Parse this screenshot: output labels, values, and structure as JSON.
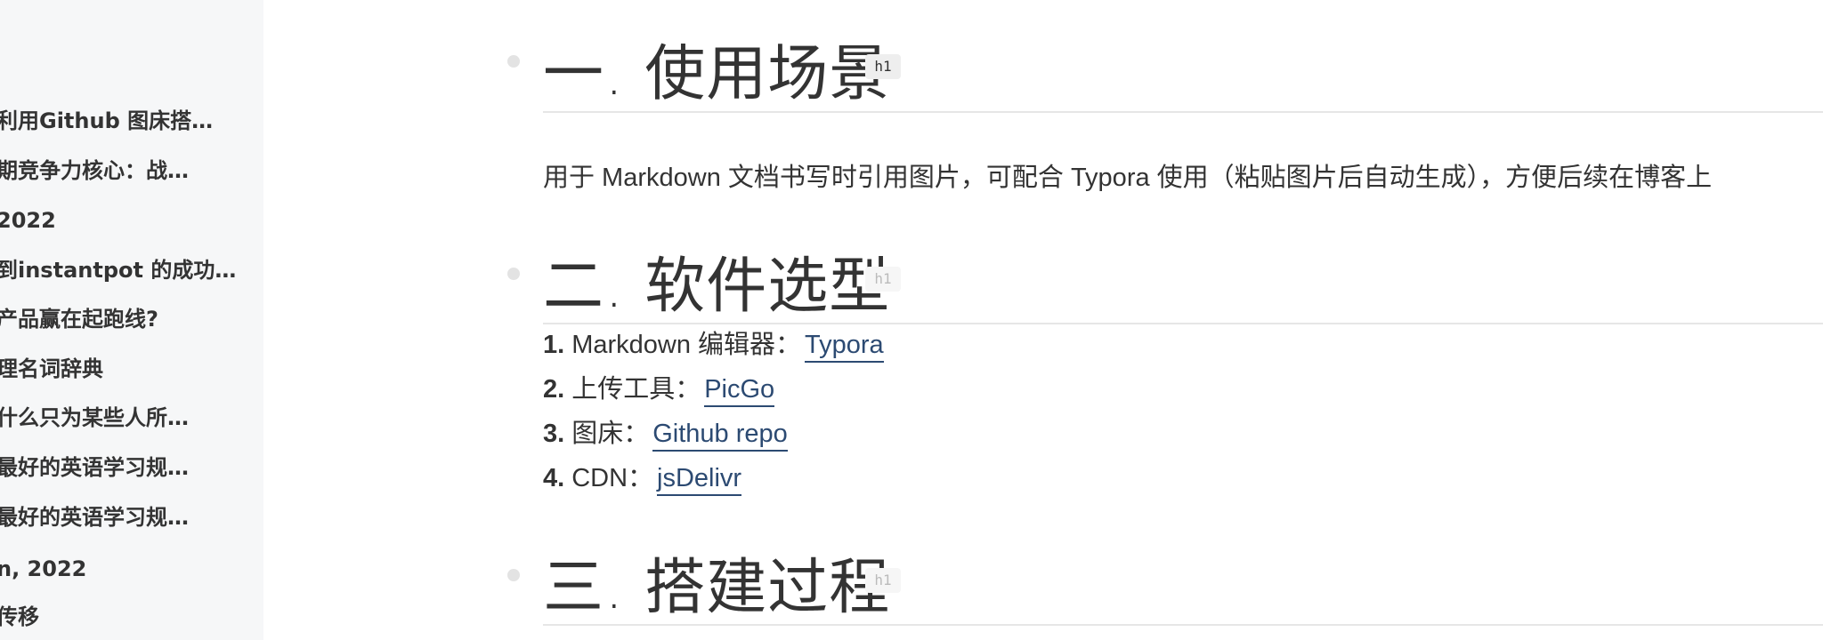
{
  "sidebar": {
    "items": [
      {
        "label": "利用Github 图床搭…"
      },
      {
        "label": "期竞争力核心：战…"
      },
      {
        "label": " 2022"
      },
      {
        "label": "到instantpot 的成功…"
      },
      {
        "label": "产品赢在起跑线?"
      },
      {
        "label": "理名词辞典"
      },
      {
        "label": "什么只为某些人所…"
      },
      {
        "label": "最好的英语学习规…"
      },
      {
        "label": "最好的英语学习规…"
      },
      {
        "label": "n, 2022"
      },
      {
        "label": "传移"
      }
    ]
  },
  "document": {
    "headings": [
      {
        "text": "一. 使用场景",
        "tag": "h1"
      },
      {
        "text": "二. 软件选型",
        "tag": "h1"
      },
      {
        "text": "三. 搭建过程",
        "tag": "h1"
      }
    ],
    "intro_paragraph": "用于 Markdown 文档书写时引用图片，可配合 Typora 使用（粘贴图片后自动生成），方便后续在博客上",
    "software_list": [
      {
        "number": "1.",
        "label": "Markdown 编辑器：",
        "link_text": "Typora"
      },
      {
        "number": "2.",
        "label": "上传工具：",
        "link_text": "PicGo"
      },
      {
        "number": "3.",
        "label": "图床：",
        "link_text": "Github repo"
      },
      {
        "number": "4.",
        "label": "CDN：",
        "link_text": "jsDelivr"
      }
    ]
  },
  "colors": {
    "sidebar_bg": "#f6f7f8",
    "link": "#2c4a72",
    "heading_rule": "#e6e6e6",
    "text": "#333333"
  }
}
